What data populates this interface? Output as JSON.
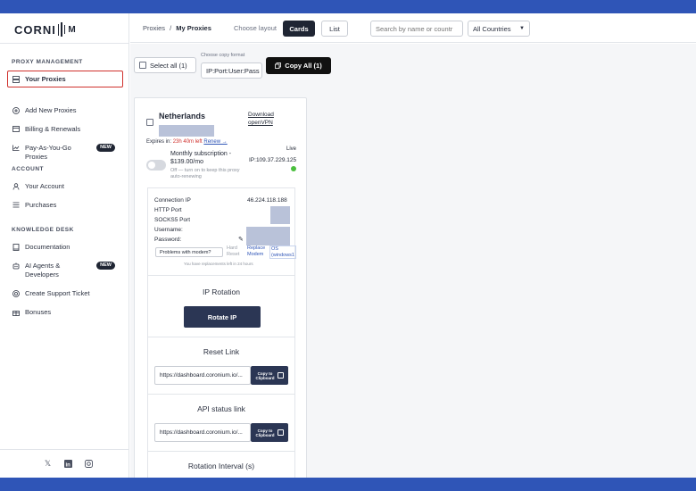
{
  "sidebar": {
    "logo": "CORNI",
    "sections": {
      "proxy": "PROXY MANAGEMENT",
      "account": "ACCOUNT",
      "knowledge": "KNOWLEDGE DESK"
    },
    "items": {
      "your_proxies": "Your Proxies",
      "add_new": "Add New Proxies",
      "billing": "Billing & Renewals",
      "payg": "Pay-As-You-Go\nProxies",
      "your_account": "Your Account",
      "purchases": "Purchases",
      "documentation": "Documentation",
      "ai_agents": "AI Agents &\nDevelopers",
      "support": "Create Support Ticket",
      "bonuses": "Bonuses"
    },
    "badge_new": "NEW",
    "icons": [
      "server-icon",
      "plus-circle-icon",
      "card-icon",
      "chart-icon",
      "user-icon",
      "list-icon",
      "book-icon",
      "robot-icon",
      "support-icon",
      "gift-icon"
    ],
    "social_icons": [
      "x-icon",
      "linkedin-icon",
      "instagram-icon"
    ]
  },
  "header": {
    "crumb_root": "Proxies",
    "crumb_sep": "/",
    "crumb_current": "My Proxies",
    "choose_layout": "Choose layout",
    "cards": "Cards",
    "list": "List",
    "search_placeholder": "Search by name or countr",
    "country_select": "All Countries"
  },
  "toolbar": {
    "select_all": "Select all (1)",
    "copy_format_label": "Choose copy format",
    "copy_format_value": "IP:Port:User:Pass",
    "copy_all": "Copy All (1)"
  },
  "card": {
    "country": "Netherlands",
    "download": "Download\nopenVPN",
    "expires_label": "Expires in:",
    "expires_value": "23h 40m left",
    "renew": "Renew →",
    "live": "Live",
    "subscription": "Monthly subscription - $139.00/mo",
    "sub_note": "Off — turn on to keep this proxy auto-renewing",
    "ip": "IP:109.37.229.125",
    "labels": {
      "connection_ip": "Connection IP",
      "http_port": "HTTP Port",
      "socks5_port": "SOCKS5 Port",
      "username": "Username:",
      "password": "Password:"
    },
    "connection_ip_value": "46.224.118.188",
    "problems": "Problems with modem?",
    "hard_reset": "Hard\nReset",
    "replace_modem": "Replace\nModem",
    "os": "OS\n(windows1",
    "replacements_note": "You have replacements left in 24 hours",
    "ip_rotation": "IP Rotation",
    "rotate_ip": "Rotate IP",
    "reset_link": "Reset Link",
    "reset_url": "https://dashboard.coronium.io/...",
    "copy_clipboard": "Copy to\nClipboard",
    "api_status": "API status link",
    "api_url": "https://dashboard.coronium.io/...",
    "rotation_interval": "Rotation Interval (s)"
  },
  "colors": {
    "brand_bar": "#2f55b7",
    "active_border": "#d0312d",
    "primary_dark": "#2b3654",
    "live_dot": "#4bbf3e"
  }
}
